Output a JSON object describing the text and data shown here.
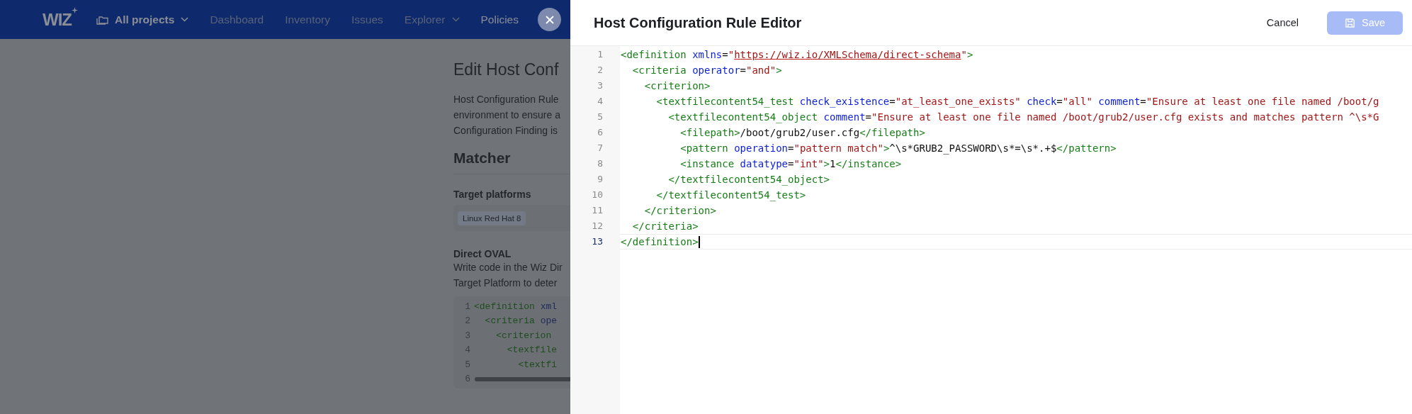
{
  "nav": {
    "logo": "WIZ",
    "project_picker": {
      "label": "All projects"
    },
    "items": [
      {
        "label": "Dashboard",
        "dropdown": false,
        "selected": false
      },
      {
        "label": "Inventory",
        "dropdown": false,
        "selected": false
      },
      {
        "label": "Issues",
        "dropdown": false,
        "selected": false
      },
      {
        "label": "Explorer",
        "dropdown": true,
        "selected": false
      },
      {
        "label": "Policies",
        "dropdown": false,
        "selected": true
      }
    ]
  },
  "background_page": {
    "title": "Edit Host Conf",
    "description_lines": [
      "Host Configuration Rule",
      "environment to ensure a",
      "Configuration Finding is"
    ],
    "section_title": "Matcher",
    "target_platforms": {
      "label": "Target platforms",
      "chips": [
        "Linux Red Hat 8"
      ]
    },
    "direct_oval": {
      "label": "Direct OVAL",
      "description_lines": [
        "Write code in the Wiz Dir",
        "Target Platform to deter"
      ],
      "code_lines": [
        {
          "number": "1",
          "tokens": [
            {
              "kind": "tag",
              "text": "<definition"
            },
            {
              "kind": "attr",
              "text": " xml"
            }
          ]
        },
        {
          "number": "2",
          "tokens": [
            {
              "kind": "tag",
              "text": "  <criteria"
            },
            {
              "kind": "attr",
              "text": " ope"
            }
          ]
        },
        {
          "number": "3",
          "tokens": [
            {
              "kind": "tag",
              "text": "    <criterion"
            }
          ]
        },
        {
          "number": "4",
          "tokens": [
            {
              "kind": "tag",
              "text": "      <textfile"
            }
          ]
        },
        {
          "number": "5",
          "tokens": [
            {
              "kind": "tag",
              "text": "        <textfi"
            }
          ]
        },
        {
          "number": "6"
        }
      ]
    }
  },
  "drawer": {
    "title": "Host Configuration Rule Editor",
    "cancel": {
      "label": "Cancel"
    },
    "save": {
      "label": "Save",
      "disabled": true
    },
    "editor": {
      "lines": [
        {
          "number": "1",
          "current": false,
          "tokens": [
            {
              "kind": "tag",
              "text": "<definition"
            },
            {
              "kind": "attr",
              "text": " xmlns"
            },
            {
              "kind": "text",
              "text": "="
            },
            {
              "kind": "str",
              "text": "\""
            },
            {
              "kind": "url",
              "text": "https://wiz.io/XMLSchema/direct-schema"
            },
            {
              "kind": "str",
              "text": "\""
            },
            {
              "kind": "tag",
              "text": ">"
            }
          ]
        },
        {
          "number": "2",
          "current": false,
          "tokens": [
            {
              "kind": "tag",
              "text": "  <criteria"
            },
            {
              "kind": "attr",
              "text": " operator"
            },
            {
              "kind": "text",
              "text": "="
            },
            {
              "kind": "str",
              "text": "\"and\""
            },
            {
              "kind": "tag",
              "text": ">"
            }
          ]
        },
        {
          "number": "3",
          "current": false,
          "tokens": [
            {
              "kind": "tag",
              "text": "    <criterion>"
            }
          ]
        },
        {
          "number": "4",
          "current": false,
          "tokens": [
            {
              "kind": "tag",
              "text": "      <textfilecontent54_test"
            },
            {
              "kind": "attr",
              "text": " check_existence"
            },
            {
              "kind": "text",
              "text": "="
            },
            {
              "kind": "str",
              "text": "\"at_least_one_exists\""
            },
            {
              "kind": "attr",
              "text": " check"
            },
            {
              "kind": "text",
              "text": "="
            },
            {
              "kind": "str",
              "text": "\"all\""
            },
            {
              "kind": "attr",
              "text": " comment"
            },
            {
              "kind": "text",
              "text": "="
            },
            {
              "kind": "str",
              "text": "\"Ensure at least one file named /boot/g"
            }
          ]
        },
        {
          "number": "5",
          "current": false,
          "tokens": [
            {
              "kind": "tag",
              "text": "        <textfilecontent54_object"
            },
            {
              "kind": "attr",
              "text": " comment"
            },
            {
              "kind": "text",
              "text": "="
            },
            {
              "kind": "str",
              "text": "\"Ensure at least one file named /boot/grub2/user.cfg exists and matches pattern ^\\s*G"
            }
          ]
        },
        {
          "number": "6",
          "current": false,
          "tokens": [
            {
              "kind": "tag",
              "text": "          <filepath>"
            },
            {
              "kind": "text",
              "text": "/boot/grub2/user.cfg"
            },
            {
              "kind": "tag",
              "text": "</filepath>"
            }
          ]
        },
        {
          "number": "7",
          "current": false,
          "tokens": [
            {
              "kind": "tag",
              "text": "          <pattern"
            },
            {
              "kind": "attr",
              "text": " operation"
            },
            {
              "kind": "text",
              "text": "="
            },
            {
              "kind": "str",
              "text": "\"pattern match\""
            },
            {
              "kind": "tag",
              "text": ">"
            },
            {
              "kind": "text",
              "text": "^\\s*GRUB2_PASSWORD\\s*=\\s*.+$"
            },
            {
              "kind": "tag",
              "text": "</pattern>"
            }
          ]
        },
        {
          "number": "8",
          "current": false,
          "tokens": [
            {
              "kind": "tag",
              "text": "          <instance"
            },
            {
              "kind": "attr",
              "text": " datatype"
            },
            {
              "kind": "text",
              "text": "="
            },
            {
              "kind": "str",
              "text": "\"int\""
            },
            {
              "kind": "tag",
              "text": ">"
            },
            {
              "kind": "text",
              "text": "1"
            },
            {
              "kind": "tag",
              "text": "</instance>"
            }
          ]
        },
        {
          "number": "9",
          "current": false,
          "tokens": [
            {
              "kind": "tag",
              "text": "        </textfilecontent54_object>"
            }
          ]
        },
        {
          "number": "10",
          "current": false,
          "tokens": [
            {
              "kind": "tag",
              "text": "      </textfilecontent54_test>"
            }
          ]
        },
        {
          "number": "11",
          "current": false,
          "tokens": [
            {
              "kind": "tag",
              "text": "    </criterion>"
            }
          ]
        },
        {
          "number": "12",
          "current": false,
          "tokens": [
            {
              "kind": "tag",
              "text": "  </criteria>"
            }
          ]
        },
        {
          "number": "13",
          "current": true,
          "tokens": [
            {
              "kind": "tag",
              "text": "</definition>"
            }
          ]
        }
      ]
    }
  }
}
